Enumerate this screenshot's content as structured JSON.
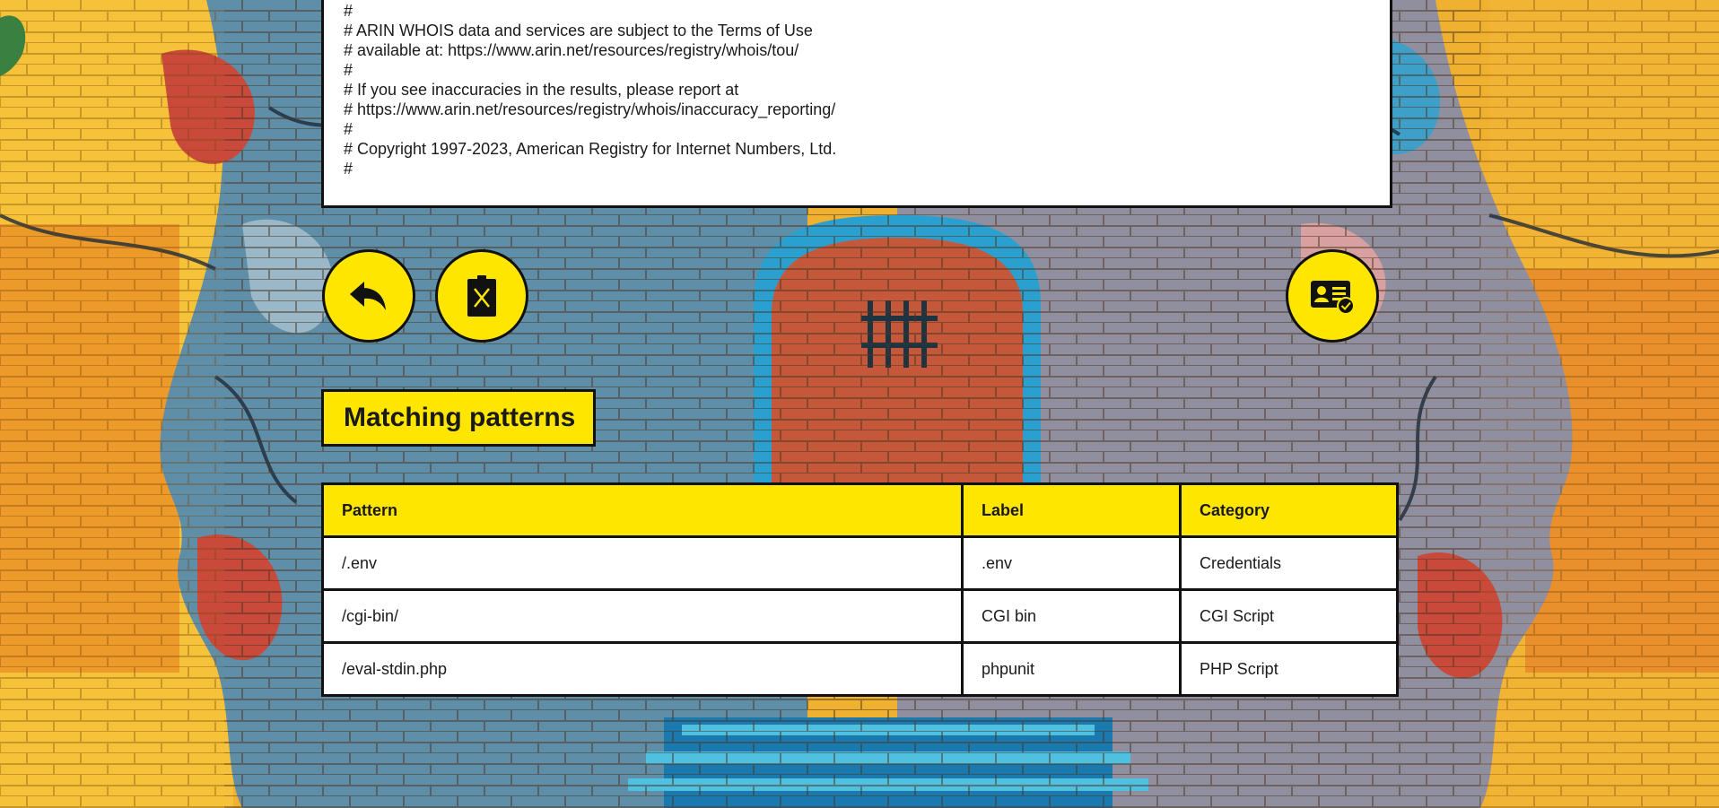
{
  "whois": {
    "lines": [
      "#",
      "# ARIN WHOIS data and services are subject to the Terms of Use",
      "# available at: https://www.arin.net/resources/registry/whois/tou/",
      "#",
      "# If you see inaccuracies in the results, please report at",
      "# https://www.arin.net/resources/registry/whois/inaccuracy_reporting/",
      "#",
      "# Copyright 1997-2023, American Registry for Internet Numbers, Ltd.",
      "#"
    ]
  },
  "actions": {
    "back_icon": "reply-arrow-icon",
    "delete_icon": "trash-x-icon",
    "contact_icon": "id-card-check-icon"
  },
  "section": {
    "title": "Matching patterns"
  },
  "table": {
    "headers": {
      "pattern": "Pattern",
      "label": "Label",
      "category": "Category"
    },
    "rows": [
      {
        "pattern": "/.env",
        "label": ".env",
        "category": "Credentials"
      },
      {
        "pattern": "/cgi-bin/",
        "label": "CGI bin",
        "category": "CGI Script"
      },
      {
        "pattern": "/eval-stdin.php",
        "label": "phpunit",
        "category": "PHP Script"
      }
    ]
  },
  "colors": {
    "accent": "#ffe600",
    "border": "#111111",
    "panel": "#ffffff"
  }
}
